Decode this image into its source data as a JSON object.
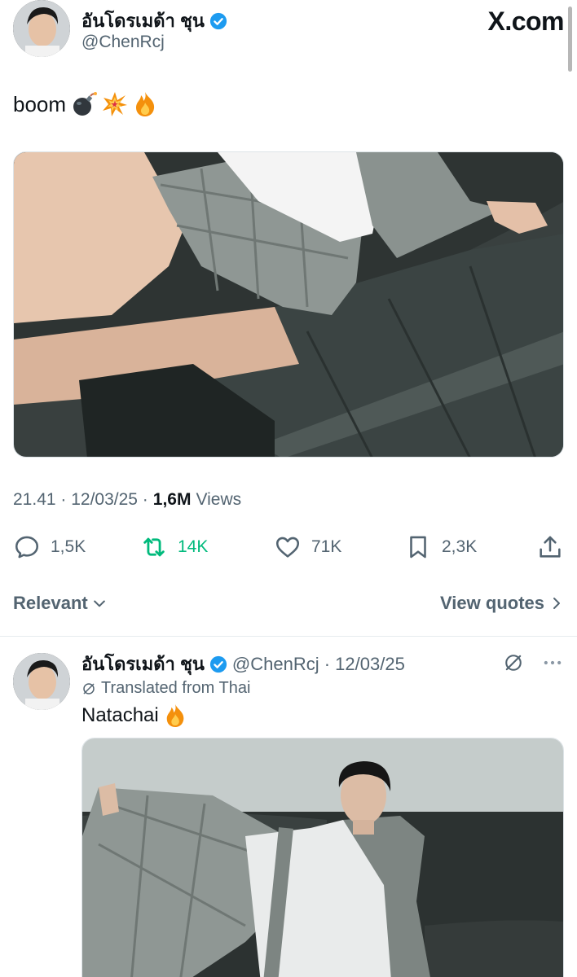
{
  "tweet": {
    "display_name": "อันโดรเมด้า ชุน",
    "handle": "@ChenRcj",
    "brand": "X.com",
    "text": "boom",
    "emojis": [
      "bomb",
      "collision",
      "fire"
    ],
    "timestamp": "21.41 · 12/03/25 ·",
    "views_count": "1,6M",
    "views_label": "Views",
    "actions": {
      "replies": "1,5K",
      "reposts": "14K",
      "likes": "71K",
      "bookmarks": "2,3K"
    }
  },
  "sort": {
    "relevant_label": "Relevant",
    "view_quotes_label": "View quotes"
  },
  "quote": {
    "display_name": "อันโดรเมด้า ชุน",
    "handle_date": "@ChenRcj · 12/03/25",
    "translated_label": "Translated from Thai",
    "text": "Natachai",
    "emojis": [
      "fire"
    ]
  },
  "colors": {
    "verified": "#1d9bf0",
    "retweet": "#00ba7c",
    "muted": "#536471"
  }
}
